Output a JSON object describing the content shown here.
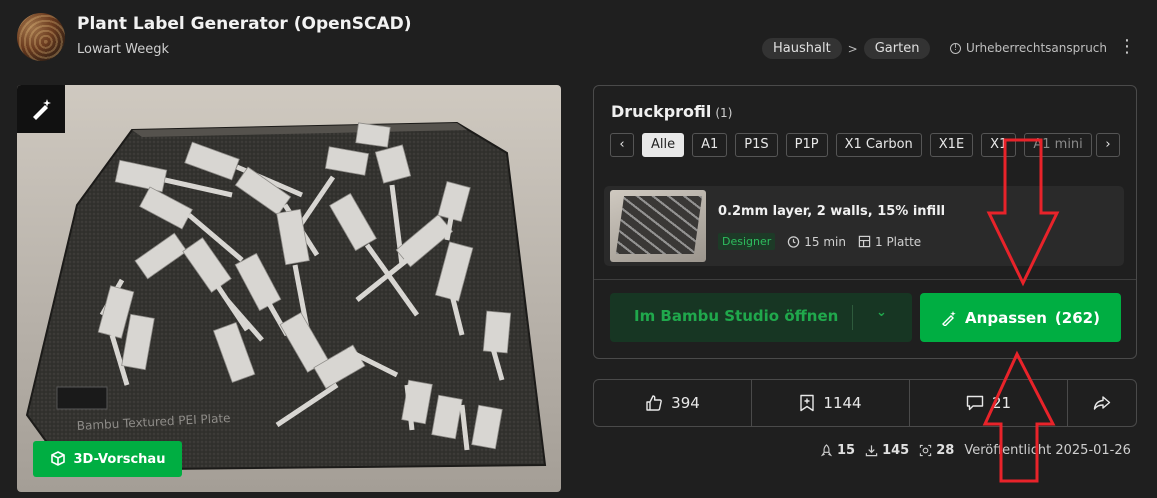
{
  "header": {
    "title": "Plant Label Generator (OpenSCAD)",
    "author": "Lowart Weegk",
    "breadcrumbs": [
      "Haushalt",
      "Garten"
    ],
    "breadcrumb_separator": ">",
    "claim": "Urheberrechtsanspruch"
  },
  "preview": {
    "button_label": "3D-Vorschau",
    "plate_text": "Bambu Textured PEI Plate"
  },
  "druckprofil": {
    "title": "Druckprofil",
    "count": "(1)",
    "tabs": [
      "Alle",
      "A1",
      "P1S",
      "P1P",
      "X1 Carbon",
      "X1E",
      "X1",
      "A1 mini"
    ],
    "active_tab": "Alle",
    "prev_arrow": "‹",
    "next_arrow": "›",
    "profile": {
      "name": "0.2mm layer, 2 walls, 15% infill",
      "badge": "Designer",
      "time": "15 min",
      "plates": "1 Platte"
    },
    "open_button": "Im Bambu Studio öffnen",
    "customize_button": "Anpassen",
    "customize_count": "(262)"
  },
  "stats": {
    "likes": "394",
    "collects": "1144",
    "comments": "21"
  },
  "footer": {
    "boosts": "15",
    "downloads": "145",
    "prints": "28",
    "published": "Veröffentlicht 2025-01-26"
  },
  "colors": {
    "accent": "#00ae42",
    "annotation": "#e8232a"
  }
}
